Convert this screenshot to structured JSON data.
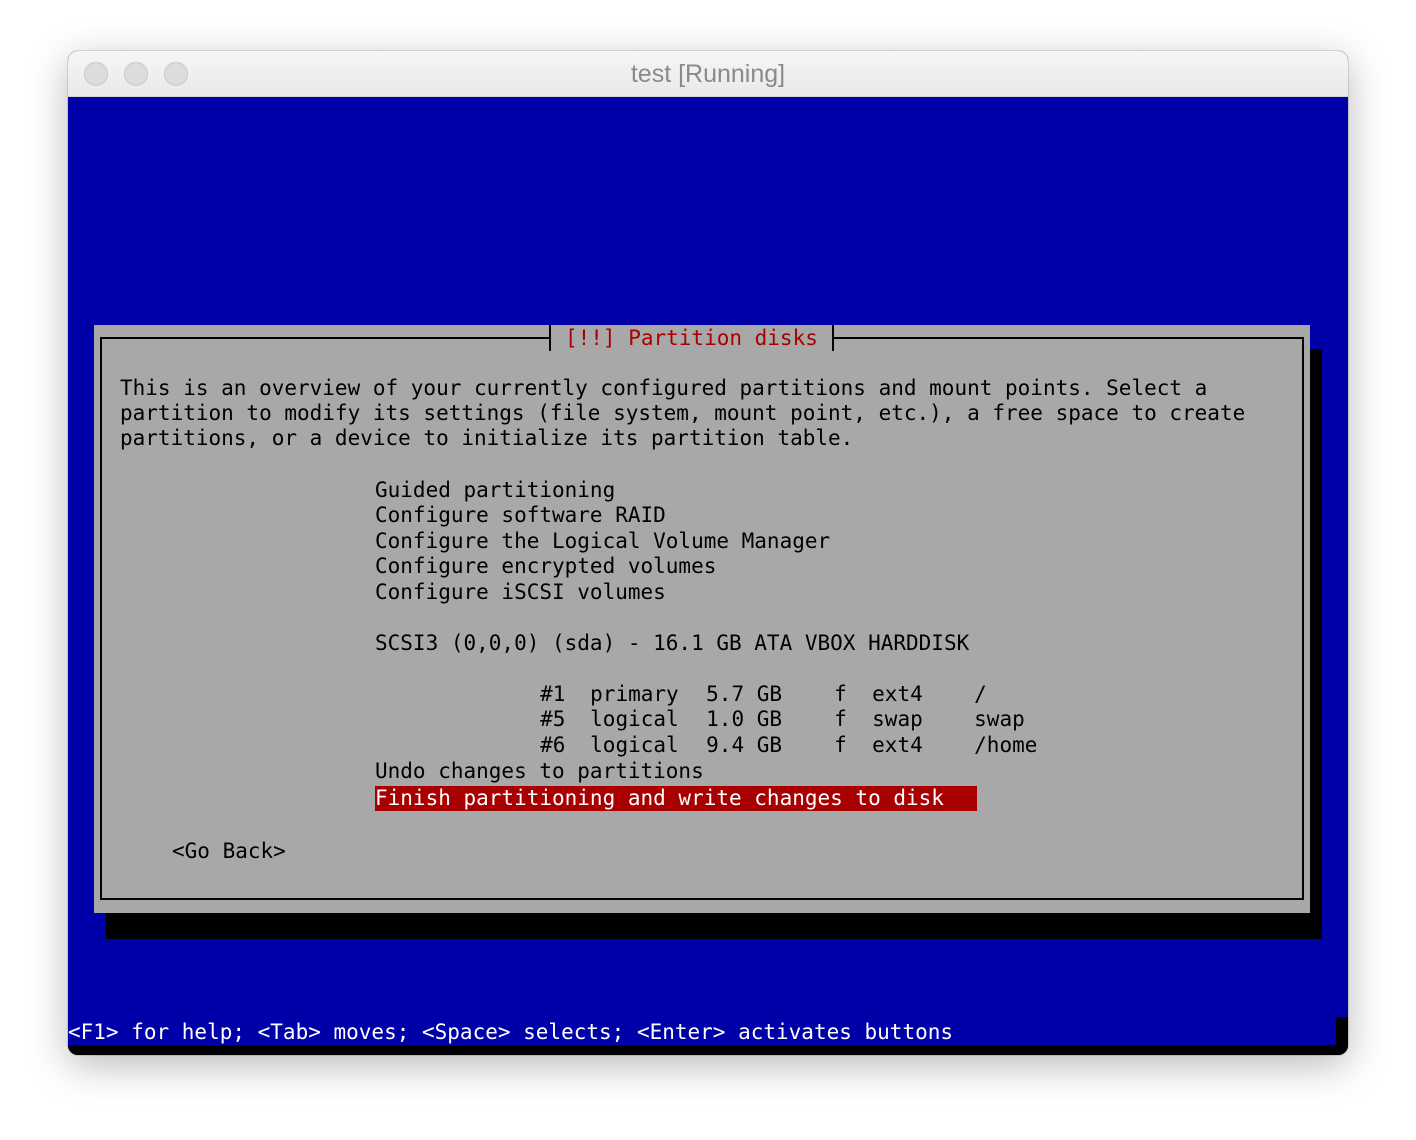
{
  "window": {
    "title": "test [Running]"
  },
  "dialog": {
    "title": "[!!] Partition disks",
    "description": [
      "This is an overview of your currently configured partitions and mount points. Select a",
      "partition to modify its settings (file system, mount point, etc.), a free space to create",
      "partitions, or a device to initialize its partition table."
    ],
    "menu_items": [
      "Guided partitioning",
      "Configure software RAID",
      "Configure the Logical Volume Manager",
      "Configure encrypted volumes",
      "Configure iSCSI volumes"
    ],
    "disk": {
      "label": "SCSI3 (0,0,0) (sda) - 16.1 GB ATA VBOX HARDDISK",
      "partitions": [
        {
          "number": "#1",
          "type": "primary",
          "size": "5.7 GB",
          "flag": "f",
          "fs": "ext4",
          "mount": "/"
        },
        {
          "number": "#5",
          "type": "logical",
          "size": "1.0 GB",
          "flag": "f",
          "fs": "swap",
          "mount": "swap"
        },
        {
          "number": "#6",
          "type": "logical",
          "size": "9.4 GB",
          "flag": "f",
          "fs": "ext4",
          "mount": "/home"
        }
      ]
    },
    "undo_label": "Undo changes to partitions",
    "finish_label": "Finish partitioning and write changes to disk",
    "go_back_label": "<Go Back>"
  },
  "statusbar": {
    "text": "<F1> for help; <Tab> moves; <Space> selects; <Enter> activates buttons"
  },
  "colors": {
    "background": "#0000a8",
    "dialog": "#a8a8a8",
    "title_text": "#a80000",
    "selection": "#a80000"
  }
}
